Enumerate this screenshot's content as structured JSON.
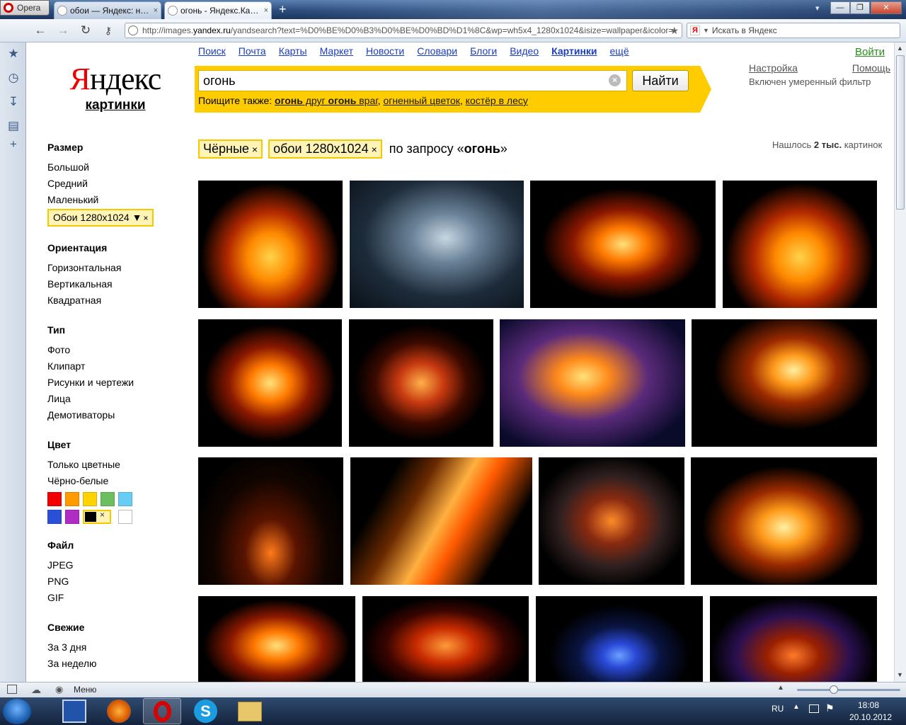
{
  "browser": {
    "menu_label": "Opera",
    "tabs": [
      {
        "title": "обои — Яндекс: нашл...",
        "close": "×"
      },
      {
        "title": "огонь - Яндекс.Картин...",
        "close": "×"
      }
    ],
    "new_tab": "+",
    "window_controls": {
      "minimize": "—",
      "restore": "❐",
      "close": "✕"
    },
    "tab_menu": "▾",
    "address": {
      "prefix": "http://images.",
      "host": "yandex.ru",
      "path": "/yandsearch?text=%D0%BE%D0%B3%D0%BE%D0%BD%D1%8C&wp=wh5x4_1280x1024&isize=wallpaper&icolor="
    },
    "search_engine_placeholder": "Искать в Яндекс",
    "status_menu": "Меню"
  },
  "page": {
    "logo": {
      "first_letter": "Я",
      "rest": "ндекс",
      "sub": "картинки"
    },
    "services": [
      "Поиск",
      "Почта",
      "Карты",
      "Маркет",
      "Новости",
      "Словари",
      "Блоги",
      "Видео",
      "Картинки",
      "ещё"
    ],
    "current_service": "Картинки",
    "login": "Войти",
    "query": "огонь",
    "clear": "×",
    "find_button": "Найти",
    "also_label": "Поищите также:",
    "also": [
      {
        "parts": [
          {
            "t": "огонь",
            "b": true
          },
          {
            "t": " друг ",
            "b": false
          },
          {
            "t": "огонь",
            "b": true
          },
          {
            "t": " враг",
            "b": false
          }
        ]
      },
      {
        "parts": [
          {
            "t": "огненный цветок",
            "b": false
          }
        ]
      },
      {
        "parts": [
          {
            "t": "костёр в лесу",
            "b": false
          }
        ]
      }
    ],
    "settings": "Настройка",
    "help": "Помощь",
    "filter_note": "Включен умеренный фильтр",
    "chips": [
      {
        "label": "Чёрные",
        "x": "×"
      },
      {
        "label": "обои 1280x1024",
        "x": "×"
      }
    ],
    "by_request_prefix": "по запросу «",
    "by_request_query": "огонь",
    "by_request_suffix": "»",
    "found": {
      "prefix": "Нашлось",
      "count": "2 тыс.",
      "suffix": "картинок"
    },
    "filters": {
      "size": {
        "head": "Размер",
        "items": [
          "Большой",
          "Средний",
          "Маленький"
        ],
        "selected": "Обои 1280x1024 ▼",
        "x": "×"
      },
      "orientation": {
        "head": "Ориентация",
        "items": [
          "Горизонтальная",
          "Вертикальная",
          "Квадратная"
        ]
      },
      "type": {
        "head": "Тип",
        "items": [
          "Фото",
          "Клипарт",
          "Рисунки и чертежи",
          "Лица",
          "Демотиваторы"
        ]
      },
      "color": {
        "head": "Цвет",
        "items": [
          "Только цветные",
          "Чёрно-белые"
        ],
        "swatches": [
          "#f40000",
          "#ff9a00",
          "#ffd200",
          "#6cbf5f",
          "#66cdf5",
          "#2b50d8",
          "#b02cc4"
        ],
        "selected_swatch": "#000000",
        "selected_x": "×",
        "white_swatch": "#ffffff"
      },
      "file": {
        "head": "Файл",
        "items": [
          "JPEG",
          "PNG",
          "GIF"
        ]
      },
      "fresh": {
        "head": "Свежие",
        "items": [
          "За 3 дня",
          "За неделю"
        ]
      }
    }
  },
  "taskbar": {
    "lang": "RU",
    "time": "18:08",
    "date": "20.10.2012"
  },
  "colors": {
    "accent_yellow": "#ffcc00",
    "link_blue": "#1a3dc1",
    "login_green": "#2a8c1b",
    "logo_red": "#ee0000"
  },
  "icons": [
    "star-icon",
    "history-icon",
    "downloads-icon",
    "notes-icon",
    "add-panel-icon",
    "back-icon",
    "forward-icon",
    "reload-icon",
    "key-icon",
    "globe-icon",
    "bookmark-star-icon"
  ]
}
